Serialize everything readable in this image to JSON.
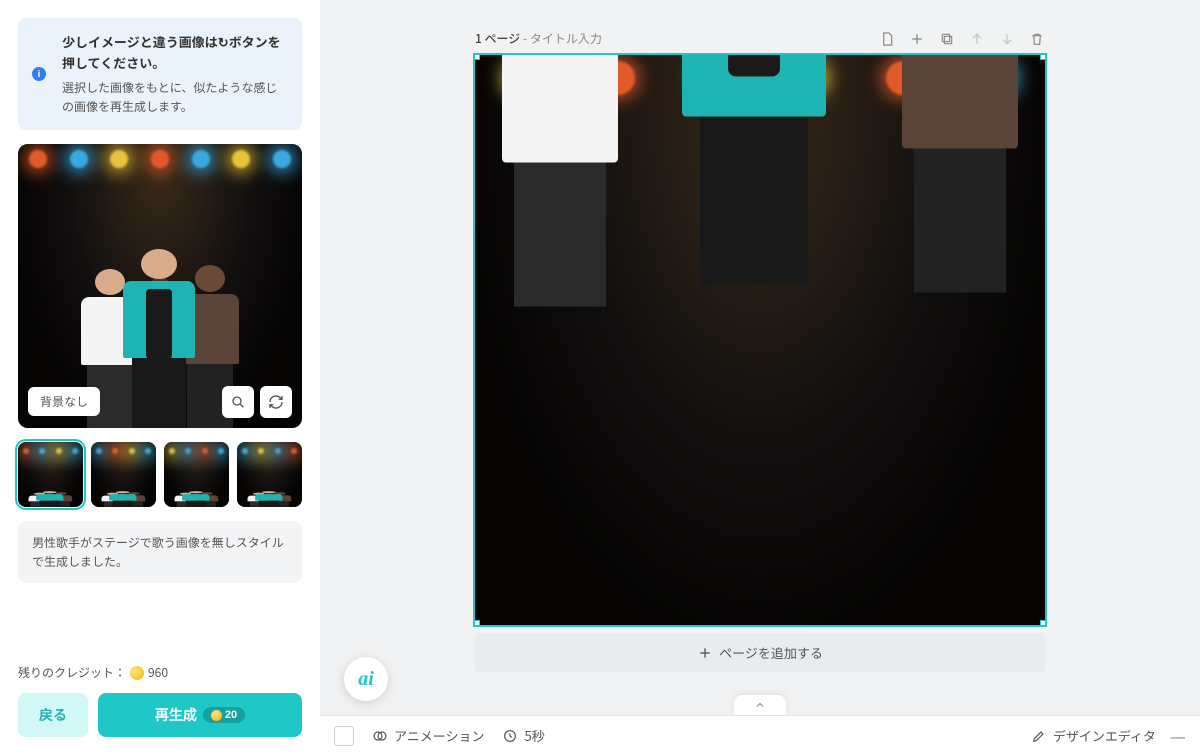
{
  "info": {
    "title": "少しイメージと違う画像は↻ボタンを押してください。",
    "desc": "選択した画像をもとに、似たような感じの画像を再生成します。"
  },
  "preview": {
    "no_bg_label": "背景なし"
  },
  "caption": "男性歌手がステージで歌う画像を無しスタイルで生成しました。",
  "credits": {
    "label": "残りのクレジット：",
    "amount": "960"
  },
  "buttons": {
    "back": "戻る",
    "regenerate": "再生成",
    "regen_cost": "20"
  },
  "canvas": {
    "page_prefix": "1 ページ",
    "title_placeholder": "タイトル入力",
    "add_page": "ページを追加する"
  },
  "toolbar": {
    "animation": "アニメーション",
    "duration": "5秒",
    "design_editor": "デザインエディタ",
    "ai_label": "ai"
  }
}
